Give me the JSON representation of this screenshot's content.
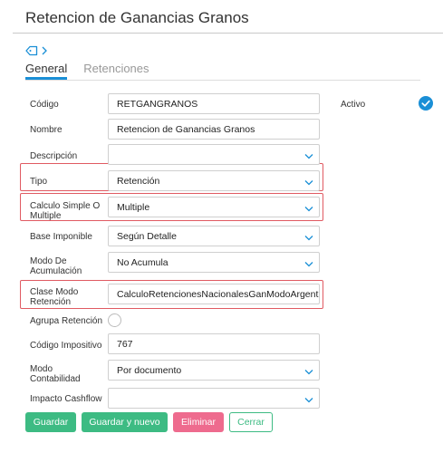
{
  "page": {
    "title": "Retencion de Ganancias Granos"
  },
  "tabs": [
    "General",
    "Retenciones"
  ],
  "icons": {
    "tag": "tag-icon",
    "chevron": "chevron-right-icon",
    "check": "check-circle-icon",
    "dropdown": "chevron-down-icon"
  },
  "colors": {
    "accent": "#1a8fd6",
    "highlight": "#e05a62",
    "green": "#3dbb83",
    "pink": "#ee6b8e"
  },
  "fields": {
    "codigo": {
      "label": "Código",
      "value": "RETGANGRANOS"
    },
    "nombre": {
      "label": "Nombre",
      "value": "Retencion de Ganancias Granos"
    },
    "descripcion": {
      "label": "Descripción",
      "value": ""
    },
    "tipo": {
      "label": "Tipo",
      "value": "Retención"
    },
    "calculo": {
      "label_line1": "Calculo Simple O",
      "label_line2": "Multiple",
      "value": "Multiple"
    },
    "base": {
      "label": "Base Imponible",
      "value": "Según Detalle"
    },
    "modo_acum": {
      "label_line1": "Modo De",
      "label_line2": "Acumulación",
      "value": "No Acumula"
    },
    "clase_modo": {
      "label_line1": "Clase Modo",
      "label_line2": "Retención",
      "value": "CalculoRetencionesNacionalesGanModoArgent"
    },
    "agrupa": {
      "label": "Agrupa Retención",
      "checked": false
    },
    "codigo_imp": {
      "label": "Código Impositivo",
      "value": "767"
    },
    "modo_cont": {
      "label_line1": "Modo",
      "label_line2": "Contabilidad",
      "value": "Por documento"
    },
    "impacto": {
      "label": "Impacto Cashflow",
      "value": ""
    }
  },
  "activo": {
    "label": "Activo",
    "checked": true
  },
  "buttons": {
    "guardar": "Guardar",
    "nuevo": "Guardar y nuevo",
    "eliminar": "Eliminar",
    "cerrar": "Cerrar"
  }
}
